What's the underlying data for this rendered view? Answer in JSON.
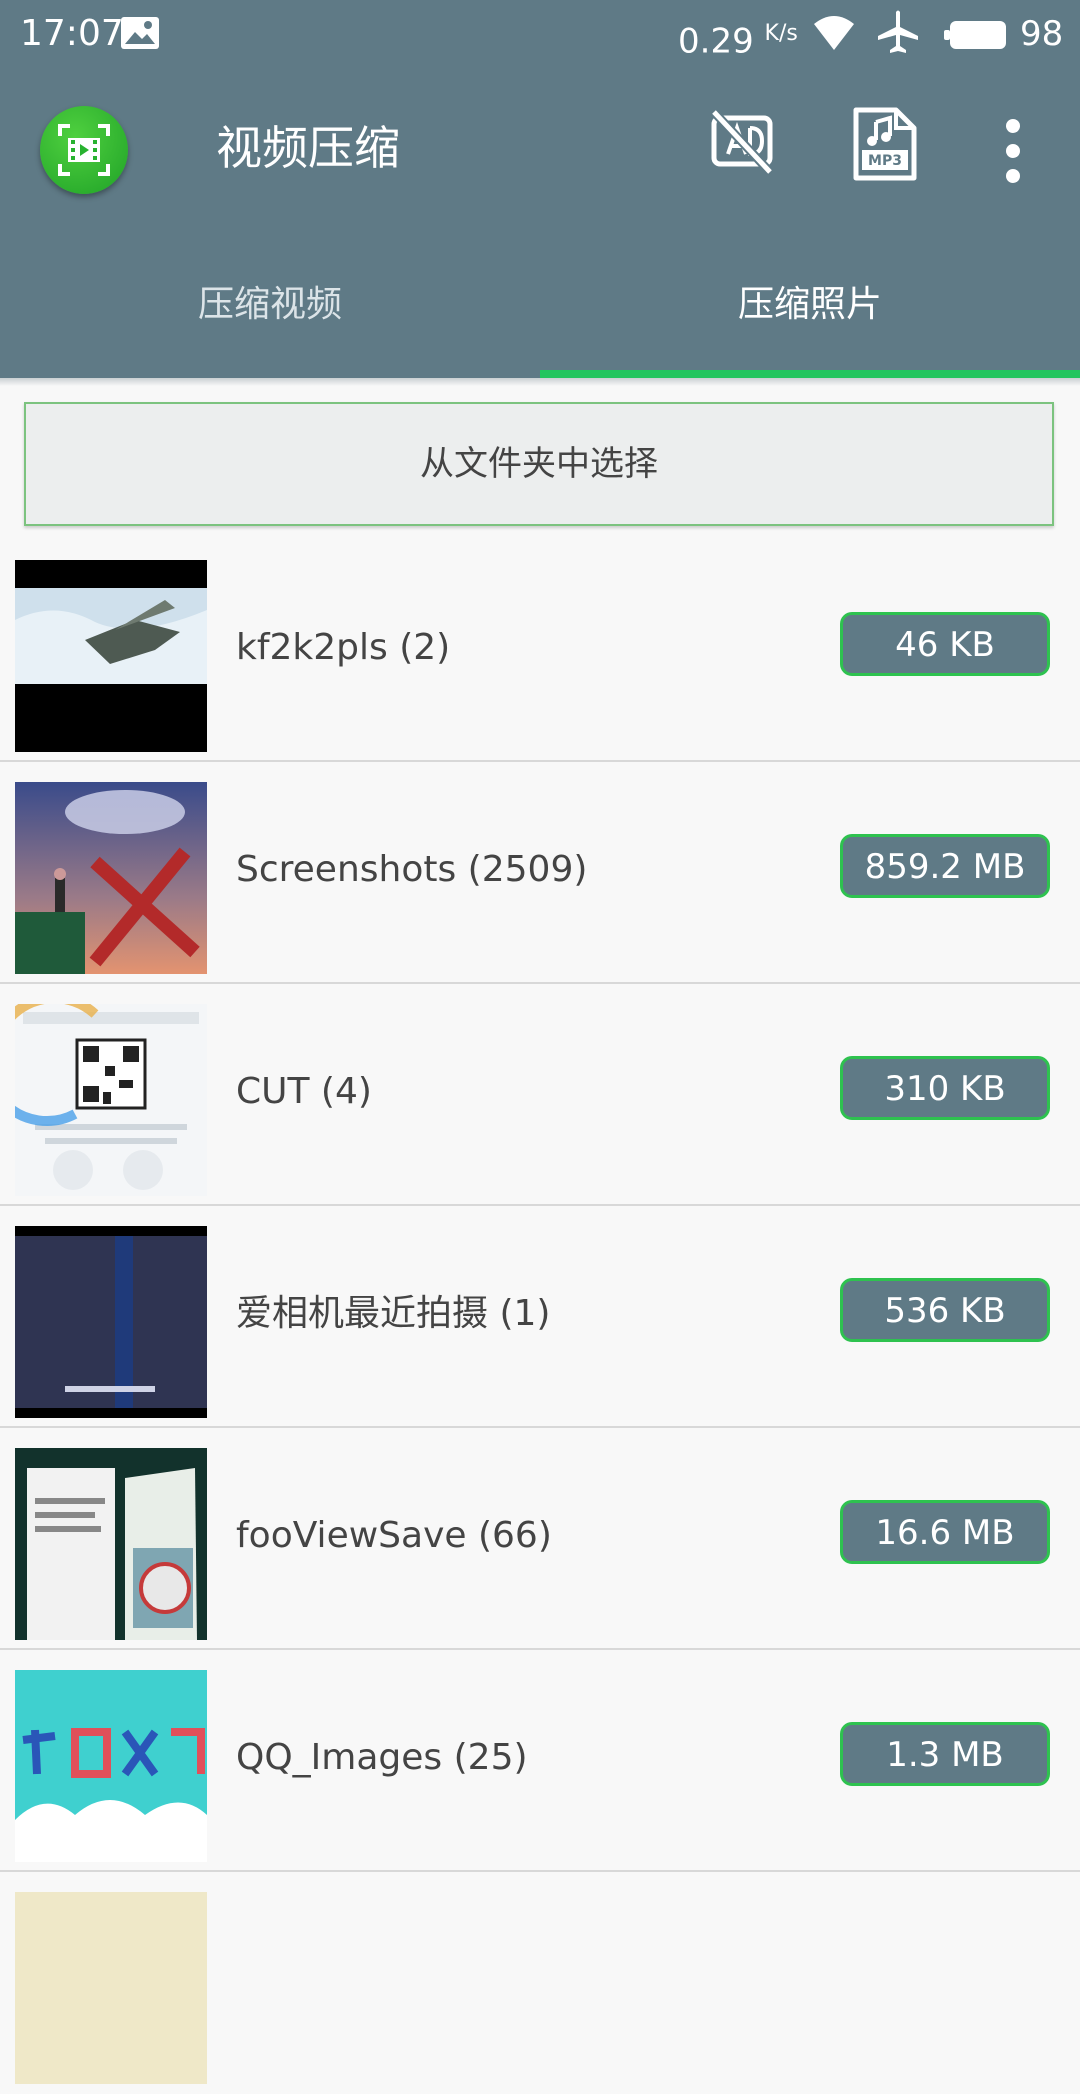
{
  "status_bar": {
    "time": "17:07",
    "speed": "0.29",
    "speed_unit": "K/s",
    "battery": "98"
  },
  "app_bar": {
    "title": "视频压缩",
    "icons": [
      "app-logo-icon",
      "hide-ad-icon",
      "mp3-file-icon",
      "more-vert-icon"
    ]
  },
  "tabs": [
    {
      "label": "压缩视频",
      "selected": false
    },
    {
      "label": "压缩照片",
      "selected": true
    }
  ],
  "choose_button": {
    "label": "从文件夹中选择"
  },
  "folders": [
    {
      "name": "kf2k2pls (2)",
      "size": "46 KB"
    },
    {
      "name": "Screenshots (2509)",
      "size": "859.2 MB"
    },
    {
      "name": "CUT (4)",
      "size": "310 KB"
    },
    {
      "name": "爱相机最近拍摄 (1)",
      "size": "536 KB"
    },
    {
      "name": "fooViewSave (66)",
      "size": "16.6 MB"
    },
    {
      "name": "QQ_Images (25)",
      "size": "1.3 MB"
    }
  ],
  "colors": {
    "primary": "#5f7a86",
    "accent": "#22c55e",
    "badge_border": "#2ec24f",
    "background": "#f8f8f8"
  }
}
